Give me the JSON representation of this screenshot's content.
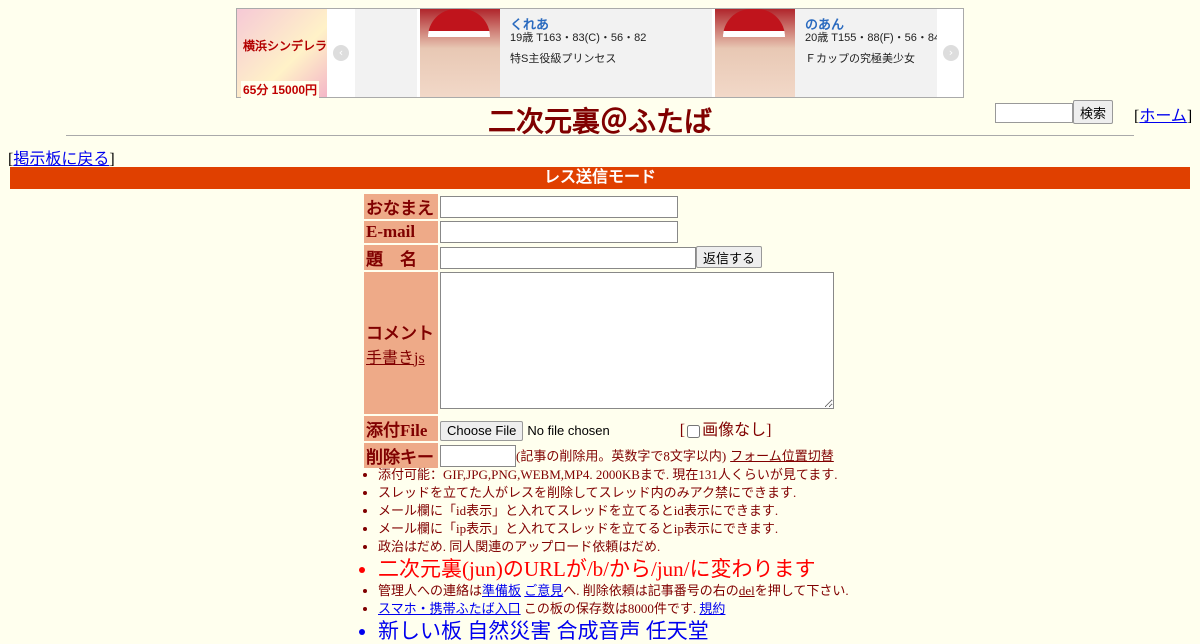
{
  "banner": {
    "ad_text1": "横浜シンデレラ",
    "ad_text2": "65分 15000円",
    "prev_arrow": "‹",
    "next_arrow": "›",
    "cards": [
      {
        "name": "くれあ",
        "spec": "19歳 T163・83(C)・56・82",
        "tag": "特S主役級プリンセス"
      },
      {
        "name": "のあん",
        "spec": "20歳 T155・88(F)・56・84",
        "tag": "Ｆカップの究極美少女"
      }
    ]
  },
  "header": {
    "title": "二次元裏＠ふたば",
    "search_placeholder": "",
    "search_button": "検索",
    "home_prefix": "[",
    "home_link": "ホーム",
    "home_suffix": "]"
  },
  "nav": {
    "back_prefix": "[",
    "back_link": "掲示板に戻る",
    "back_suffix": "]"
  },
  "mode_label": "レス送信モード",
  "form": {
    "name_label": "おなまえ",
    "email_label": "E-mail",
    "subject_label": "題　名",
    "submit_button": "返信する",
    "comment_label": "コメント",
    "handwrite_link": "手書きjs",
    "file_label": "添付File",
    "file_button": "Choose File",
    "file_status": "No file chosen",
    "noimage_prefix": "[",
    "noimage_label": "画像なし]",
    "delkey_label": "削除キー",
    "delkey_note": "(記事の削除用。英数字で8文字以内)",
    "form_toggle_link": "フォーム位置切替"
  },
  "notes": {
    "n1": "添付可能：GIF,JPG,PNG,WEBM,MP4. 2000KBまで. 現在131人くらいが見てます.",
    "n2": "スレッドを立てた人がレスを削除してスレッド内のみアク禁にできます.",
    "n3": "メール欄に「id表示」と入れてスレッドを立てるとid表示にできます.",
    "n4": "メール欄に「ip表示」と入れてスレッドを立てるとip表示にできます.",
    "n5": "政治はだめ. 同人関連のアップロード依頼はだめ.",
    "n6": "二次元裏(jun)のURLが/b/から/jun/に変わります",
    "n7_pre": "管理人への連絡は",
    "n7_link1": "準備板",
    "n7_link2": "ご意見",
    "n7_mid": "へ. 削除依頼は記事番号の右の",
    "n7_link3": "del",
    "n7_post": "を押して下さい.",
    "n8_link1": "スマホ・携帯ふたば入口",
    "n8_mid": "この板の保存数は8000件です.",
    "n8_link2": "規約",
    "n9": "新しい板 自然災害 合成音声 任天堂"
  }
}
